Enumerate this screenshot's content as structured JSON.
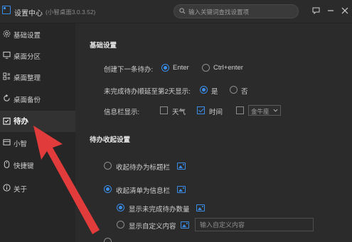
{
  "titlebar": {
    "app_title": "设置中心",
    "app_version": "(小智桌面3.0.3.52)",
    "search_placeholder": "输入关键词查找设置项"
  },
  "sidebar": {
    "items": [
      {
        "label": "基础设置",
        "icon": "gear-icon",
        "active": false
      },
      {
        "label": "桌面分区",
        "icon": "monitor-icon",
        "active": false
      },
      {
        "label": "桌面整理",
        "icon": "grid-icon",
        "active": false
      },
      {
        "label": "桌面备份",
        "icon": "backup-icon",
        "active": false
      },
      {
        "label": "待办",
        "icon": "todo-icon",
        "active": true
      },
      {
        "label": "小智",
        "icon": "box-icon",
        "active": false
      },
      {
        "label": "快捷键",
        "icon": "mouse-icon",
        "active": false
      },
      {
        "label": "关于",
        "icon": "info-icon",
        "active": false
      }
    ]
  },
  "basic": {
    "title": "基础设置",
    "next_todo_label": "创建下一条待办:",
    "next_todo_options": [
      "Enter",
      "Ctrl+enter"
    ],
    "next_todo_selected": "Enter",
    "carryover_label": "未完成待办顺延至第2天显示:",
    "carryover_options": [
      "是",
      "否"
    ],
    "carryover_selected": "是",
    "infobar_label": "信息栏显示:",
    "infobar_options": [
      {
        "label": "天气",
        "checked": false
      },
      {
        "label": "时间",
        "checked": true
      },
      {
        "label": "",
        "checked": false
      }
    ],
    "zodiac_value": "金牛座"
  },
  "collapse": {
    "title": "待办收起设置",
    "option1": "收起待办为标题栏",
    "option2": "收起清单为信息栏",
    "selected": "收起清单为信息栏",
    "sub_option1": "显示未完成待办数量",
    "sub_option2": "显示自定义内容",
    "sub_selected": "显示未完成待办数量",
    "custom_placeholder": "输入自定义内容"
  },
  "colors": {
    "accent": "#3a8de8",
    "arrow": "#e23b3b",
    "background": "#2b2b2b",
    "sidebar": "#262626"
  }
}
